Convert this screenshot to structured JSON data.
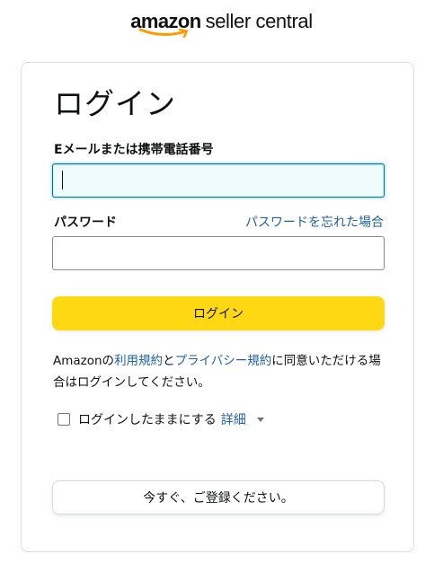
{
  "logo": {
    "brand": "amazon",
    "product": "seller central",
    "smile_color": "#ff9900"
  },
  "form": {
    "title": "ログイン",
    "email_label": "Eメールまたは携帯電話番号",
    "email_value": "",
    "password_label": "パスワード",
    "password_value": "",
    "forgot_password_link": "パスワードを忘れた場合",
    "submit_label": "ログイン",
    "legal": {
      "prefix": "Amazonの",
      "terms_link": "利用規約",
      "and": "と",
      "privacy_link": "プライバシー規約",
      "suffix": "に同意いただける場合はログインしてください。"
    },
    "remember_me": {
      "label": "ログインしたままにする",
      "checked": false,
      "details_link": "詳細"
    },
    "register_label": "今すぐ、ご登録ください。"
  },
  "colors": {
    "primary_button": "#ffd814",
    "link": "#2162a1",
    "focus_border": "#007185"
  },
  "icons": {
    "logo_smile": "amazon-smile-icon",
    "details_caret": "caret-down-icon"
  }
}
